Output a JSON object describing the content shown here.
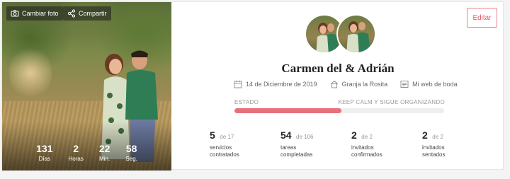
{
  "photo": {
    "change_photo_label": "Cambiar foto",
    "share_label": "Compartir",
    "countdown": [
      {
        "value": "131",
        "unit": "Días"
      },
      {
        "value": "2",
        "unit": "Horas"
      },
      {
        "value": "22",
        "unit": "Min."
      },
      {
        "value": "58",
        "unit": "Seg."
      }
    ]
  },
  "header": {
    "edit_label": "Editar",
    "couple_names": "Carmen del & Adrián"
  },
  "meta": {
    "date": "14 de Diciembre de 2019",
    "venue": "Granja la Rosita",
    "website": "Mi web de boda"
  },
  "progress": {
    "label_left": "ESTADO",
    "label_right": "KEEP CALM Y SIGUE ORGANIZANDO",
    "fraction": 0.51,
    "color": "#e8707a"
  },
  "stats": [
    {
      "value": "5",
      "of": "de 17",
      "label": "servicios contratados"
    },
    {
      "value": "54",
      "of": "de 106",
      "label": "tareas completadas"
    },
    {
      "value": "2",
      "of": "de 2",
      "label": "invitados confirmados"
    },
    {
      "value": "2",
      "of": "de 2",
      "label": "invitados sentados"
    }
  ],
  "colors": {
    "accent": "#e05a66"
  }
}
